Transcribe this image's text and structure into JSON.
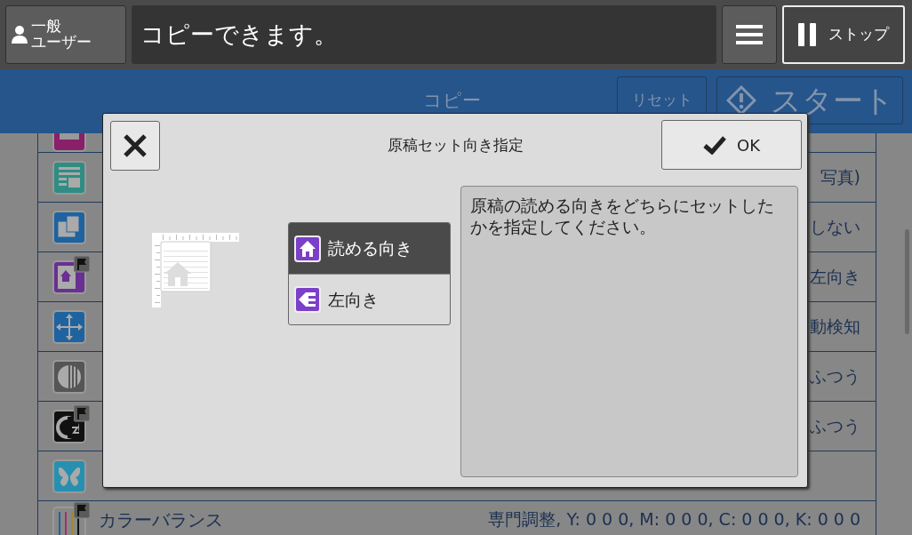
{
  "top_bar": {
    "user_button": [
      "一般",
      "ユーザー"
    ],
    "message": "コピーできます。",
    "stop_button": "ストップ"
  },
  "app_bar": {
    "title": "コピー",
    "reset_button": "リセット",
    "start_button": "スタート"
  },
  "settings": [
    {
      "kind": "magenta",
      "flagged": false
    },
    {
      "kind": "document",
      "flagged": false,
      "value": "写真)"
    },
    {
      "kind": "pages",
      "flagged": false,
      "value": "しない"
    },
    {
      "kind": "orientation",
      "flagged": true,
      "value": "左向き"
    },
    {
      "kind": "arrows",
      "flagged": false,
      "value": "動検知"
    },
    {
      "kind": "gradation",
      "flagged": false,
      "value": "ふつう"
    },
    {
      "kind": "contrast",
      "flagged": true,
      "value": "ふつう"
    },
    {
      "kind": "butterfly",
      "flagged": false
    },
    {
      "kind": "balance",
      "flagged": true,
      "label": "カラーバランス",
      "value": "専門調整, Y: 0 0 0, M: 0 0 0, C: 0 0 0, K: 0 0 0"
    }
  ],
  "dialog": {
    "title": "原稿セット向き指定",
    "ok_button": "OK",
    "options": [
      {
        "label": "読める向き",
        "kind": "home",
        "selected": true
      },
      {
        "label": "左向き",
        "kind": "left",
        "selected": false
      }
    ],
    "description": "原稿の読める向きをどちらにセットしたかを指定してください。"
  }
}
